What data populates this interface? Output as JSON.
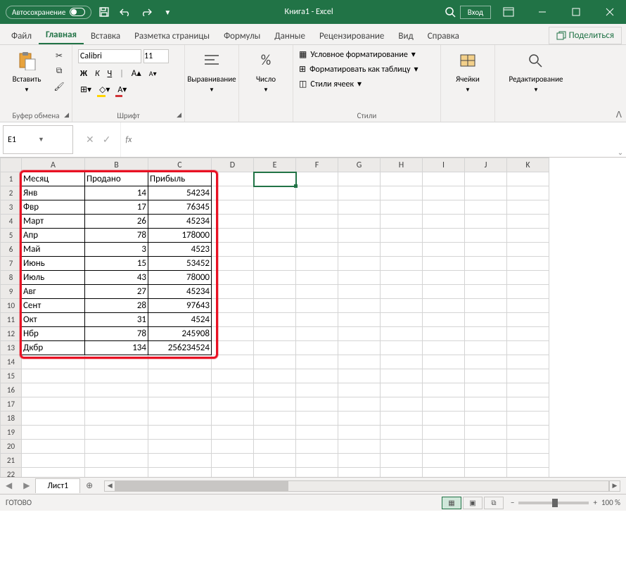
{
  "titlebar": {
    "autosave": "Автосохранение",
    "title": "Книга1 - Excel",
    "signin": "Вход"
  },
  "tabs": {
    "file": "Файл",
    "home": "Главная",
    "insert": "Вставка",
    "layout": "Разметка страницы",
    "formulas": "Формулы",
    "data": "Данные",
    "review": "Рецензирование",
    "view": "Вид",
    "help": "Справка",
    "share": "Поделиться"
  },
  "ribbon": {
    "paste": "Вставить",
    "clipboard": "Буфер обмена",
    "font_name": "Calibri",
    "font_size": "11",
    "font_group": "Шрифт",
    "b": "Ж",
    "i": "К",
    "u": "Ч",
    "alignment": "Выравнивание",
    "number": "Число",
    "cond_fmt": "Условное форматирование",
    "fmt_table": "Форматировать как таблицу",
    "cell_styles": "Стили ячеек",
    "styles_group": "Стили",
    "cells": "Ячейки",
    "editing": "Редактирование"
  },
  "namebox": "E1",
  "columns": [
    "A",
    "B",
    "C",
    "D",
    "E",
    "F",
    "G",
    "H",
    "I",
    "J",
    "K"
  ],
  "rows": [
    "1",
    "2",
    "3",
    "4",
    "5",
    "6",
    "7",
    "8",
    "9",
    "10",
    "11",
    "12",
    "13",
    "14",
    "15",
    "16",
    "17",
    "18",
    "19",
    "20",
    "21",
    "22"
  ],
  "headers": {
    "a": "Месяц",
    "b": "Продано",
    "c": "Прибыль"
  },
  "data": [
    {
      "m": "Янв",
      "s": "14",
      "p": "54234"
    },
    {
      "m": "Фвр",
      "s": "17",
      "p": "76345"
    },
    {
      "m": "Март",
      "s": "26",
      "p": "45234"
    },
    {
      "m": "Апр",
      "s": "78",
      "p": "178000"
    },
    {
      "m": "Май",
      "s": "3",
      "p": "4523"
    },
    {
      "m": "Июнь",
      "s": "15",
      "p": "53452"
    },
    {
      "m": "Июль",
      "s": "43",
      "p": "78000"
    },
    {
      "m": "Авг",
      "s": "27",
      "p": "45234"
    },
    {
      "m": "Сент",
      "s": "28",
      "p": "97643"
    },
    {
      "m": "Окт",
      "s": "31",
      "p": "4524"
    },
    {
      "m": "Нбр",
      "s": "78",
      "p": "245908"
    },
    {
      "m": "Дкбр",
      "s": "134",
      "p": "256234524"
    }
  ],
  "sheet": "Лист1",
  "status": "ГОТОВО",
  "zoom": "100 %"
}
